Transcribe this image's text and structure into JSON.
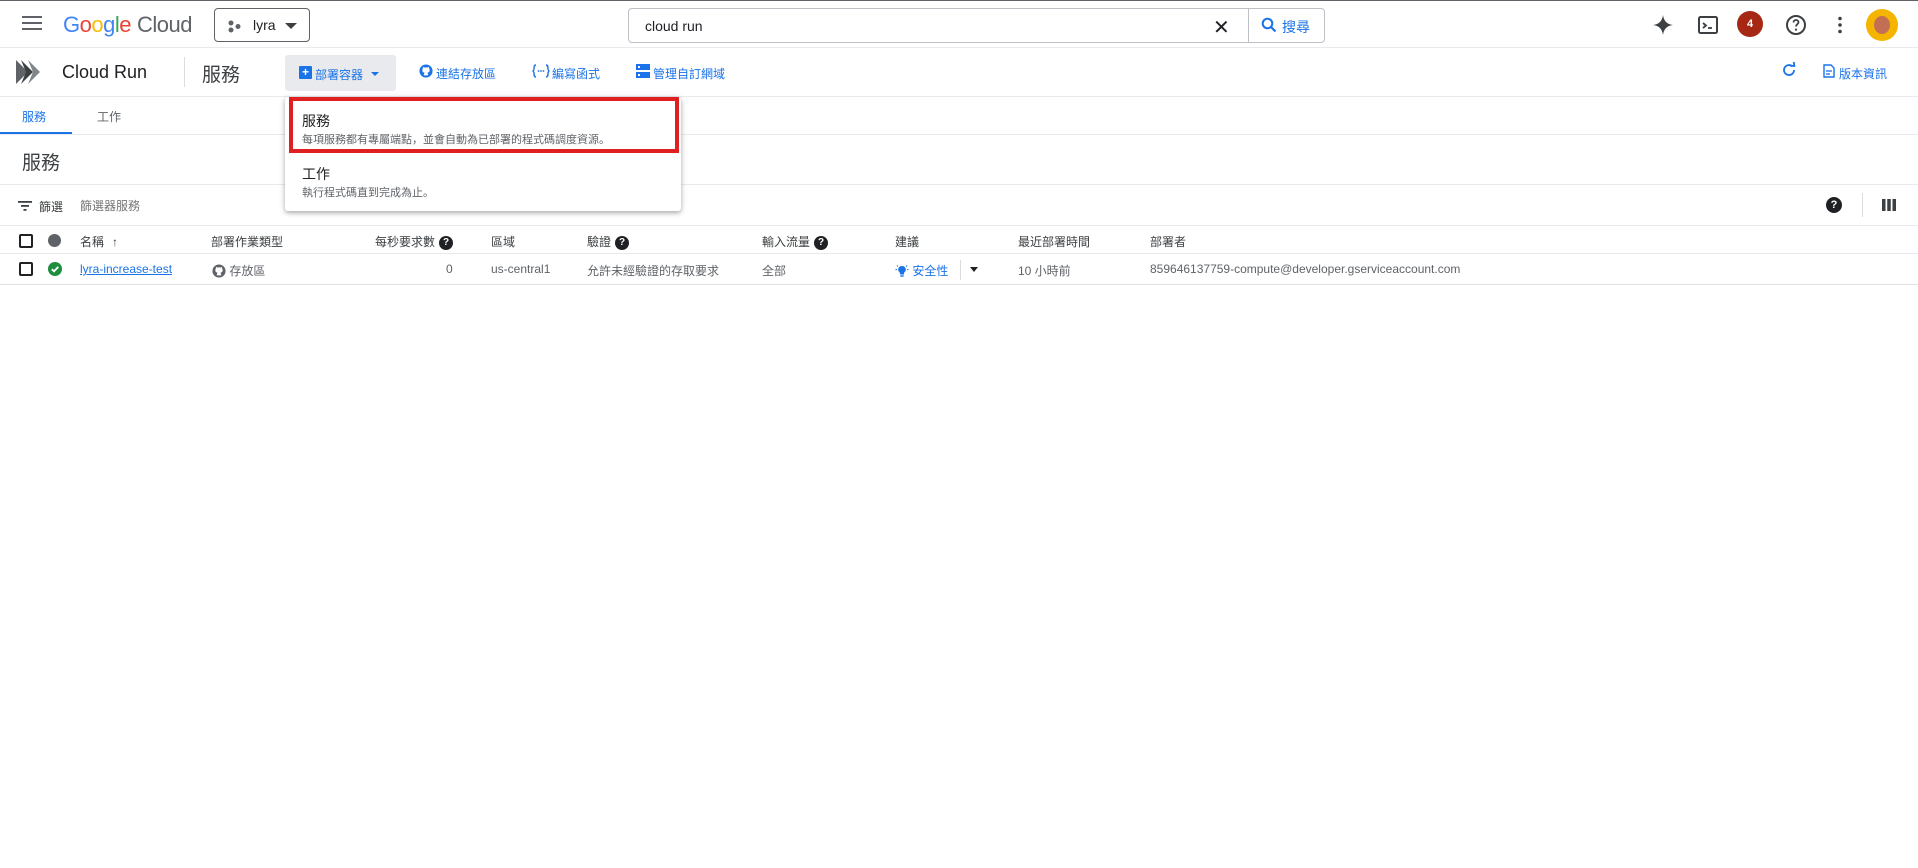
{
  "topbar": {
    "logo_google": [
      "G",
      "o",
      "o",
      "g",
      "l",
      "e"
    ],
    "logo_cloud": "Cloud",
    "project_name": "lyra",
    "search_value": "cloud run",
    "search_button_label": "搜尋",
    "notification_count": "4"
  },
  "subbar": {
    "product_title": "Cloud Run",
    "page_title": "服務",
    "deploy_container_label": "部署容器",
    "connect_repo_label": "連結存放區",
    "write_function_label": "編寫函式",
    "manage_domains_label": "管理自訂網域",
    "release_notes_label": "版本資訊"
  },
  "tabs": [
    {
      "label": "服務",
      "active": true
    },
    {
      "label": "工作",
      "active": false
    }
  ],
  "section_title": "服務",
  "filter": {
    "label": "篩選",
    "placeholder": "篩選器服務"
  },
  "table": {
    "headers": {
      "name": "名稱",
      "deploy_type": "部署作業類型",
      "rps": "每秒要求數",
      "region": "區域",
      "auth": "驗證",
      "ingress": "輸入流量",
      "recommendation": "建議",
      "last_deployed": "最近部署時間",
      "deployer": "部署者"
    },
    "rows": [
      {
        "name": "lyra-increase-test",
        "deploy_type": "存放區",
        "rps": "0",
        "region": "us-central1",
        "auth": "允許未經驗證的存取要求",
        "ingress": "全部",
        "recommendation": "安全性",
        "last_deployed": "10 小時前",
        "deployer": "859646137759-compute@developer.gserviceaccount.com"
      }
    ]
  },
  "deploy_menu": {
    "items": [
      {
        "title": "服務",
        "desc": "每項服務都有專屬端點，並會自動為已部署的程式碼調度資源。"
      },
      {
        "title": "工作",
        "desc": "執行程式碼直到完成為止。"
      }
    ]
  },
  "colors": {
    "accent": "#1a73e8",
    "highlight_box": "#e02020",
    "status_ok": "#1e8e3e",
    "notification_badge": "#a52714"
  },
  "icons": [
    "menu-icon",
    "project-icon",
    "clear-icon",
    "search-icon",
    "gemini-icon",
    "cloud-shell-icon",
    "help-icon",
    "more-vert-icon",
    "cloud-run-logo-icon",
    "plus-icon",
    "github-icon",
    "code-icon",
    "domain-icon",
    "refresh-icon",
    "release-notes-icon",
    "filter-icon",
    "columns-icon",
    "check-circle-icon",
    "sort-arrow-up-icon",
    "lightbulb-icon"
  ]
}
